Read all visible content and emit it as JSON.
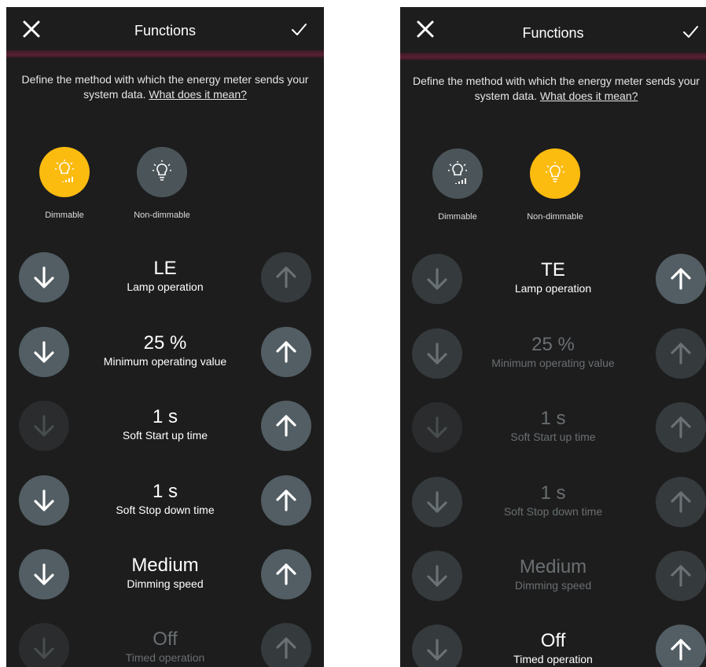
{
  "left": {
    "title": "Functions",
    "description": "Define the method with which the energy meter sends your system data.",
    "description_link": "What does it mean?",
    "modes": [
      {
        "label": "Dimmable",
        "selected": true
      },
      {
        "label": "Non-dimmable",
        "selected": false
      }
    ],
    "rows": [
      {
        "value": "LE",
        "label": "Lamp operation"
      },
      {
        "value": "25 %",
        "label": "Minimum operating value"
      },
      {
        "value": "1 s",
        "label": "Soft Start up time"
      },
      {
        "value": "1 s",
        "label": "Soft Stop down time"
      },
      {
        "value": "Medium",
        "label": "Dimming speed"
      },
      {
        "value": "Off",
        "label": "Timed operation"
      }
    ]
  },
  "right": {
    "title": "Functions",
    "description": "Define the method with which the energy meter sends your system data.",
    "description_link": "What does it mean?",
    "modes": [
      {
        "label": "Dimmable",
        "selected": false
      },
      {
        "label": "Non-dimmable",
        "selected": true
      }
    ],
    "rows": [
      {
        "value": "TE",
        "label": "Lamp operation"
      },
      {
        "value": "25 %",
        "label": "Minimum operating value"
      },
      {
        "value": "1 s",
        "label": "Soft Start up time"
      },
      {
        "value": "1 s",
        "label": "Soft Stop down time"
      },
      {
        "value": "Medium",
        "label": "Dimming speed"
      },
      {
        "value": "Off",
        "label": "Timed operation"
      }
    ]
  },
  "colors": {
    "selected_mode": "#fbbb0f",
    "unselected_mode": "#4b5559",
    "active_arrow": "#525e63",
    "background": "#1d1d1e"
  },
  "icons": {
    "close": "close-icon",
    "confirm": "checkmark-icon",
    "dimmable": "dimmable-bulb-icon",
    "non_dimmable": "bulb-icon",
    "decrease": "arrow-down-icon",
    "increase": "arrow-up-icon"
  }
}
